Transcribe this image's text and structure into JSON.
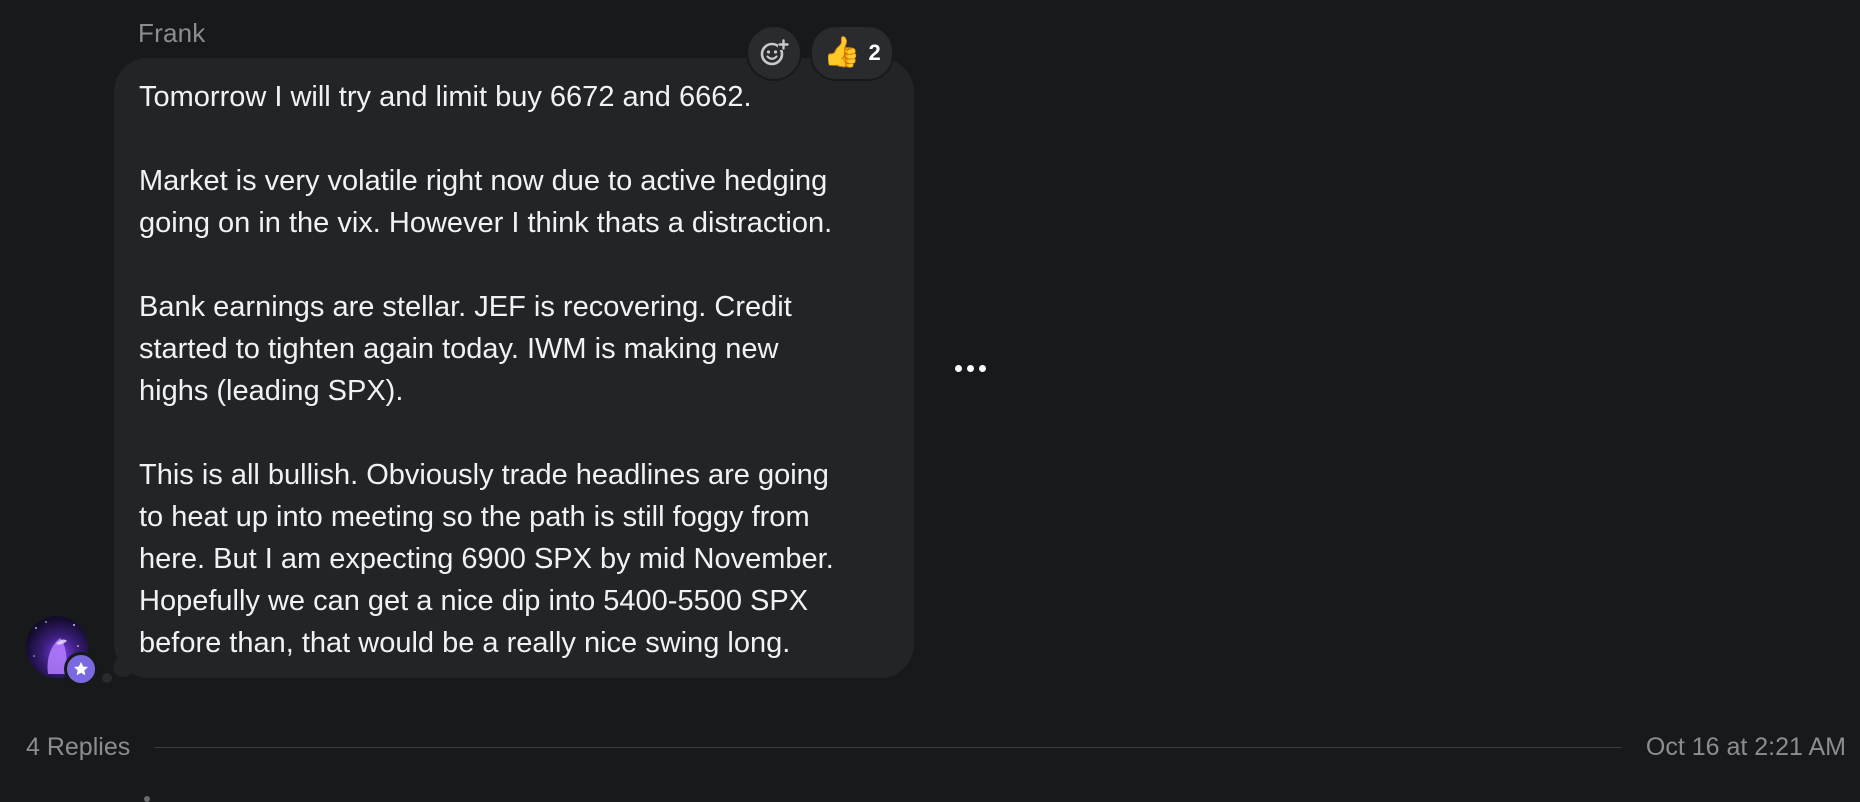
{
  "message": {
    "sender": "Frank",
    "paragraphs": [
      "Tomorrow I will try and limit buy 6672 and 6662.",
      "Market is very volatile right now due to active hedging\ngoing on in the vix. However I think thats a distraction.",
      "Bank earnings are stellar. JEF is recovering. Credit\nstarted to tighten again today. IWM is making new\nhighs (leading SPX).",
      "This is all bullish. Obviously trade headlines are going\nto heat up into meeting so the path is still foggy from\nhere. But I am expecting 6900 SPX by mid November.\nHopefully we can get a nice dip into 5400-5500 SPX\nbefore than, that would be a really nice swing long."
    ],
    "reactions": [
      {
        "emoji": "👍",
        "count": "2",
        "icon": "thumbs-up-icon"
      }
    ],
    "add_reaction_icon": "add-reaction-icon",
    "more_icon": "more-horizontal-icon",
    "avatar_badge_icon": "star-icon"
  },
  "thread": {
    "replies_label": "4 Replies",
    "timestamp": "Oct 16 at 2:21 AM"
  },
  "colors": {
    "background": "#18191b",
    "bubble": "#232426",
    "muted_text": "#8b8d92",
    "badge": "#7a6ae0"
  }
}
